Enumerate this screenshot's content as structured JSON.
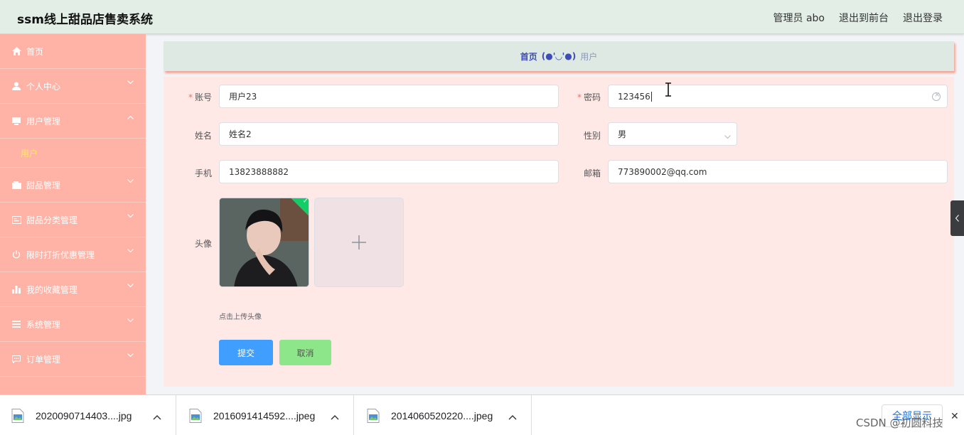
{
  "app": {
    "title": "ssm线上甜品店售卖系统"
  },
  "header": {
    "admin_label": "管理员 abo",
    "to_frontend": "退出到前台",
    "logout": "退出登录"
  },
  "sidebar": {
    "items": [
      {
        "label": "首页",
        "icon": "home-icon"
      },
      {
        "label": "个人中心",
        "icon": "user-icon"
      },
      {
        "label": "用户管理",
        "icon": "monitor-icon",
        "expanded": true
      },
      {
        "label": "甜品管理",
        "icon": "wallet-icon"
      },
      {
        "label": "甜品分类管理",
        "icon": "card-icon"
      },
      {
        "label": "限时打折优惠管理",
        "icon": "power-icon"
      },
      {
        "label": "我的收藏管理",
        "icon": "bar-chart-icon"
      },
      {
        "label": "系统管理",
        "icon": "menu-lines-icon"
      },
      {
        "label": "订单管理",
        "icon": "chat-icon"
      }
    ],
    "sub_item": "用户"
  },
  "breadcrumb": {
    "home": "首页",
    "face": "(●'◡'●)",
    "current": "用户"
  },
  "form": {
    "account_label": "账号",
    "account_value": "用户23",
    "password_label": "密码",
    "password_value": "123456",
    "name_label": "姓名",
    "name_value": "姓名2",
    "gender_label": "性别",
    "gender_value": "男",
    "phone_label": "手机",
    "phone_value": "13823888882",
    "email_label": "邮箱",
    "email_value": "773890002@qq.com",
    "avatar_label": "头像",
    "upload_hint": "点击上传头像",
    "submit_label": "提交",
    "cancel_label": "取消"
  },
  "downloads": {
    "items": [
      {
        "name": "2020090714403....jpg"
      },
      {
        "name": "2016091414592....jpeg"
      },
      {
        "name": "2014060520220....jpeg"
      }
    ],
    "show_all": "全部显示",
    "close": "✕"
  },
  "watermark": "CSDN @初圆科技",
  "colors": {
    "header_bg": "#e2eee6",
    "sidebar_bg": "#ffb3a6",
    "panel_bg": "#ffe9e7",
    "submit": "#409eff",
    "cancel": "#8ee68a",
    "submenu_text": "#ffef5a"
  }
}
